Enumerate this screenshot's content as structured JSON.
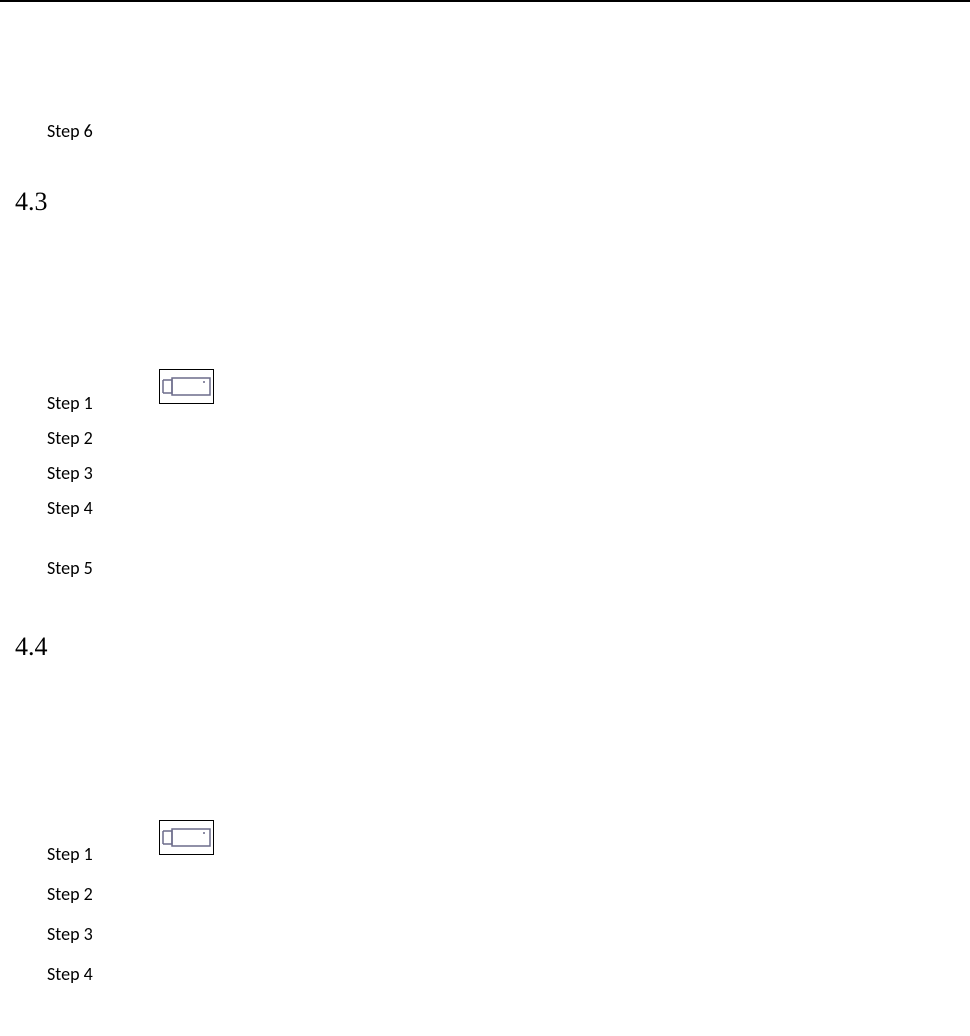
{
  "section_4_2_tail": {
    "step6": "Step 6"
  },
  "section_4_3": {
    "number": "4.3",
    "steps": [
      "Step 1",
      "Step 2",
      "Step 3",
      "Step 4",
      "Step 5"
    ],
    "icon_name": "camera-icon"
  },
  "section_4_4": {
    "number": "4.4",
    "steps": [
      "Step 1",
      "Step 2",
      "Step 3",
      "Step 4"
    ],
    "icon_name": "camera-icon"
  }
}
